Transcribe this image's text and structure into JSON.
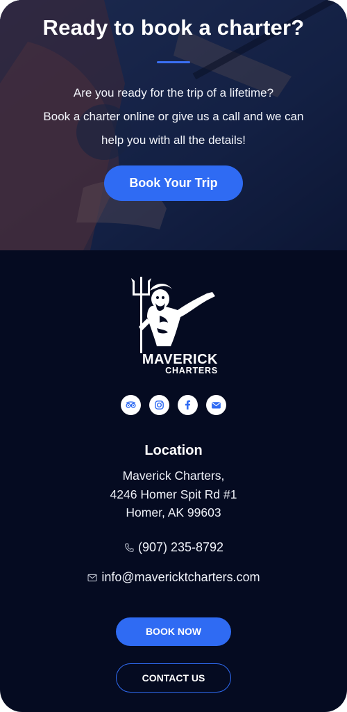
{
  "hero": {
    "title": "Ready to book a charter?",
    "lines": [
      "Are you ready for the trip of a lifetime?",
      "Book a charter online or give us a call and we can",
      "help you with all the details!"
    ],
    "button_label": "Book Your Trip"
  },
  "logo": {
    "name": "MAVERICK",
    "sub": "CHARTERS"
  },
  "social": {
    "icons": [
      "tripadvisor-icon",
      "instagram-icon",
      "facebook-icon",
      "email-icon"
    ]
  },
  "location": {
    "title": "Location",
    "address_lines": [
      "Maverick Charters,",
      "4246 Homer Spit Rd #1",
      "Homer, AK 99603"
    ],
    "phone": "(907) 235-8792",
    "email": "info@mavericktcharters.com"
  },
  "buttons": {
    "book_now": "BOOK NOW",
    "contact_us": "CONTACT US"
  },
  "colors": {
    "accent": "#2f6bf3",
    "background": "#050b21"
  }
}
